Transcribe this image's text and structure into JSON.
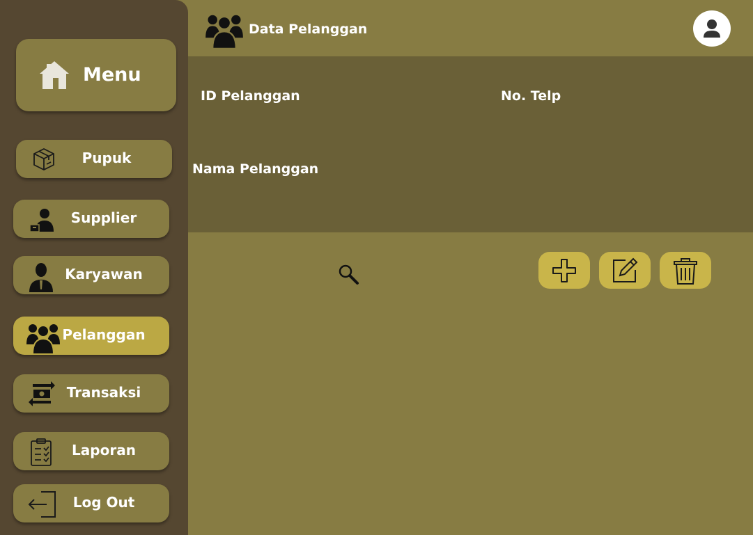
{
  "sidebar": {
    "menu_label": "Menu",
    "items": [
      {
        "label": "Pupuk"
      },
      {
        "label": "Supplier"
      },
      {
        "label": "Karyawan"
      },
      {
        "label": "Pelanggan",
        "active": true
      },
      {
        "label": "Transaksi"
      },
      {
        "label": "Laporan"
      },
      {
        "label": "Log Out"
      }
    ]
  },
  "header": {
    "title": "Data Pelanggan"
  },
  "form": {
    "id_label": "ID Pelanggan",
    "telp_label": "No. Telp",
    "nama_label": "Nama Pelanggan"
  },
  "colors": {
    "sidebar_bg": "#554731",
    "main_bg": "#877c43",
    "form_bg": "#6a6037",
    "active_item": "#bba844",
    "action_button": "#c9b54a"
  },
  "icons": {
    "menu": "home-icon",
    "pupuk": "box-icon",
    "supplier": "supplier-icon",
    "karyawan": "person-icon",
    "pelanggan": "group-icon",
    "transaksi": "exchange-icon",
    "laporan": "clipboard-icon",
    "logout": "logout-icon",
    "search": "search-icon",
    "add": "plus-icon",
    "edit": "edit-icon",
    "delete": "trash-icon"
  }
}
